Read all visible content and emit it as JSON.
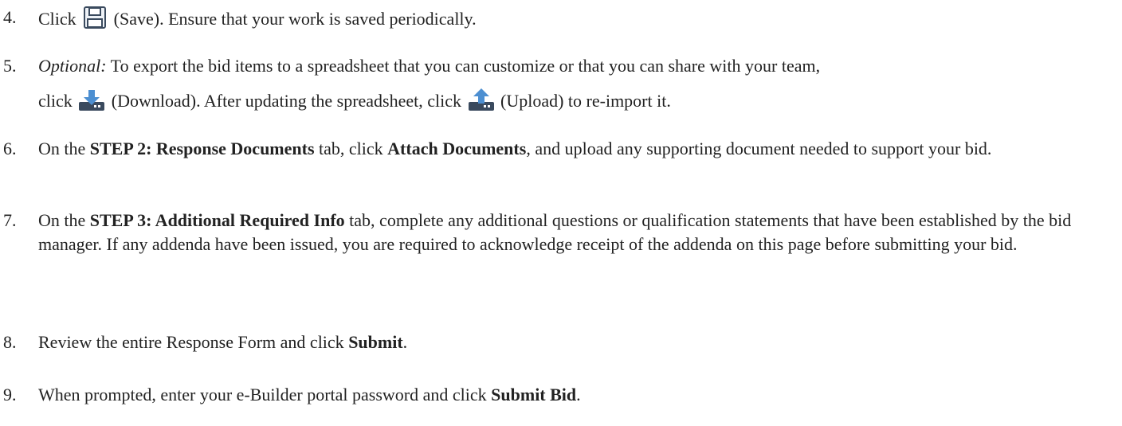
{
  "steps": [
    {
      "number": "4.",
      "parts": [
        "Click",
        "(Save). Ensure that your work is saved periodically."
      ],
      "icon": "save-icon"
    },
    {
      "number": "5.",
      "optional": "Optional:",
      "line1": "To export the bid items to a spreadsheet that you can customize or that you can share with your team,",
      "line2_parts": [
        "click",
        "(Download). After updating the spreadsheet, click",
        "(Upload) to re-import it."
      ],
      "icons": [
        "download-icon",
        "upload-icon"
      ]
    },
    {
      "number": "6.",
      "parts": [
        "On the",
        "STEP 2: Response Documents",
        "tab, click",
        "Attach Documents",
        ", and upload any supporting document needed to support your bid."
      ]
    },
    {
      "number": "7.",
      "parts": [
        "On the",
        "STEP 3: Additional Required Info",
        "tab, complete any additional questions or qualification statements that have been established by the bid manager. If any addenda have been issued, you are required to acknowledge receipt of the addenda on this page before submitting your bid."
      ]
    },
    {
      "number": "8.",
      "parts": [
        "Review the entire Response Form and click",
        "Submit",
        "."
      ]
    },
    {
      "number": "9.",
      "parts": [
        "When prompted, enter your e-Builder portal password and click",
        "Submit Bid",
        "."
      ]
    }
  ],
  "colors": {
    "text": "#222222",
    "icon": "#3a4a5e",
    "icon_accent": "#4d8fd1"
  }
}
